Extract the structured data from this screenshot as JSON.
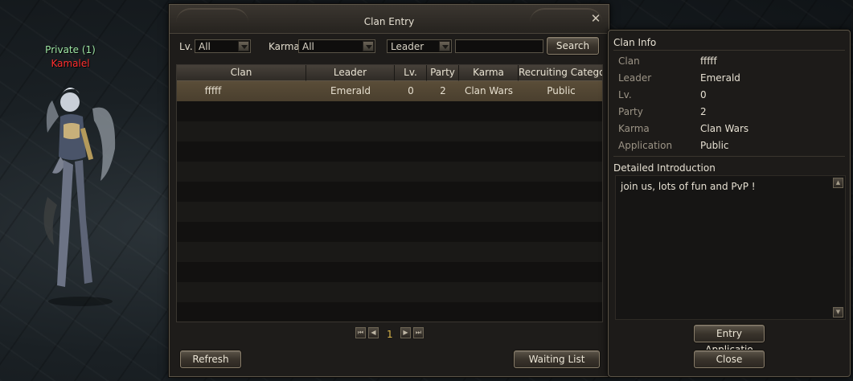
{
  "character": {
    "title": "Private (1)",
    "name": "Kamalel"
  },
  "window": {
    "title": "Clan Entry",
    "close_glyph": "✕"
  },
  "filters": {
    "level_label": "Lv.",
    "level_value": "All",
    "karma_label": "Karma",
    "karma_value": "All",
    "search_type_value": "Leader",
    "search_text": "",
    "search_button": "Search"
  },
  "table": {
    "columns": [
      "Clan",
      "Leader",
      "Lv.",
      "Party",
      "Karma",
      "Recruiting Category"
    ],
    "rows": [
      {
        "clan": "fffff",
        "leader": "Emerald",
        "level": "0",
        "party": "2",
        "karma": "Clan Wars",
        "category": "Public"
      }
    ]
  },
  "pager": {
    "current_page": "1",
    "first_icon": "⏮",
    "prev_icon": "◀",
    "next_icon": "▶",
    "last_icon": "⏭"
  },
  "buttons": {
    "refresh": "Refresh",
    "waiting_list": "Waiting List",
    "entry_application": "Entry Applicatio",
    "close": "Close"
  },
  "info": {
    "title": "Clan Info",
    "fields": [
      {
        "key": "Clan",
        "value": "fffff"
      },
      {
        "key": "Leader",
        "value": "Emerald"
      },
      {
        "key": "Lv.",
        "value": "0"
      },
      {
        "key": "Party",
        "value": "2"
      },
      {
        "key": "Karma",
        "value": "Clan Wars"
      },
      {
        "key": "Application",
        "value": "Public"
      }
    ],
    "intro_title": "Detailed Introduction",
    "intro_text": "join us, lots of fun and PvP !"
  },
  "colors": {
    "selected_row": "#5a4d38",
    "page_number": "#d9b44a",
    "character_title": "#9ee6a4",
    "character_name": "#ff2e2e"
  }
}
